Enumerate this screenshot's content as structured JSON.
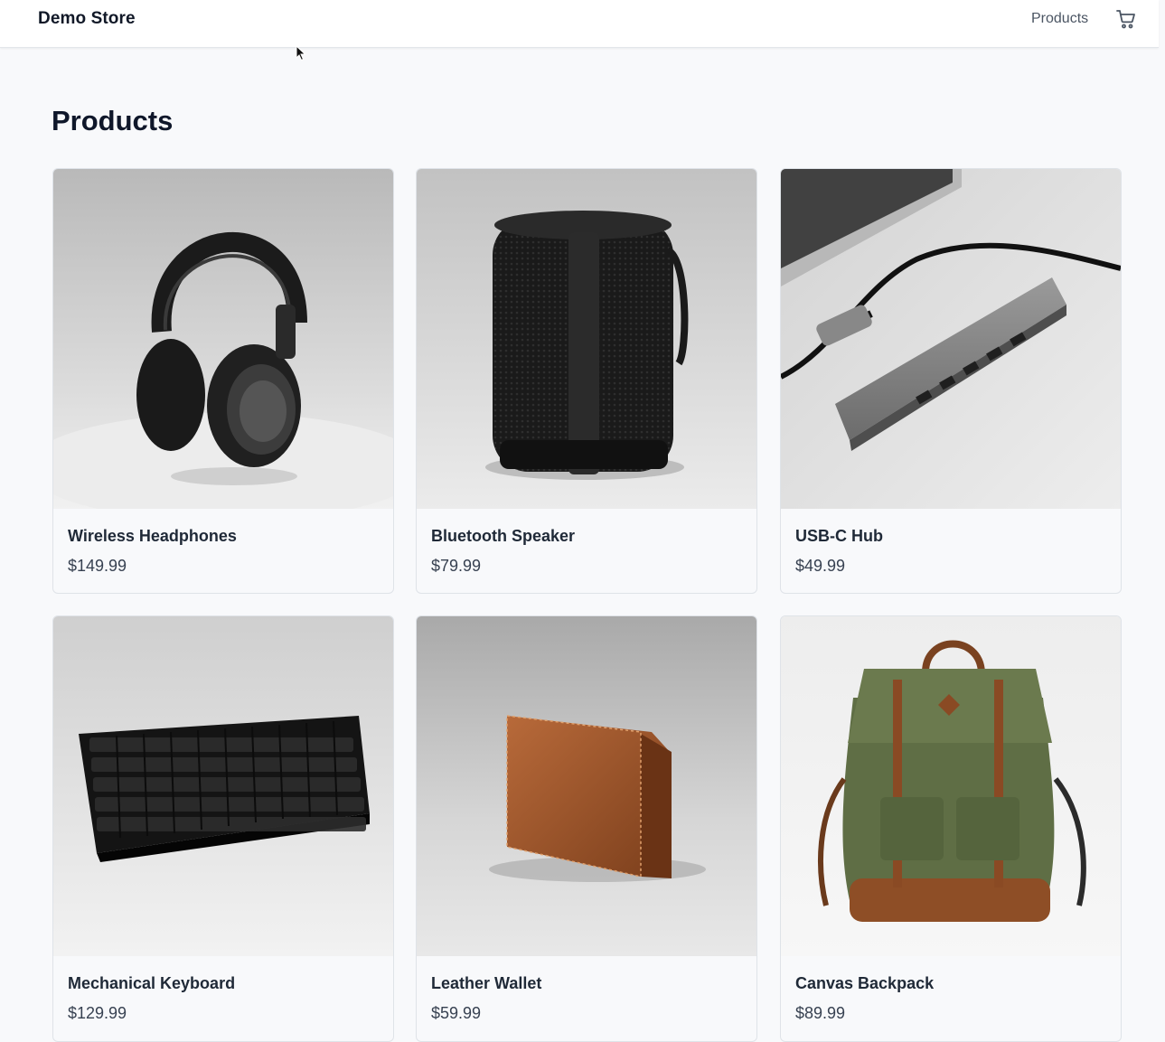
{
  "header": {
    "brand": "Demo Store",
    "nav_products": "Products",
    "cart_icon": "cart-icon"
  },
  "main": {
    "title": "Products",
    "products": [
      {
        "name": "Wireless Headphones",
        "price": "$149.99",
        "image": "headphones"
      },
      {
        "name": "Bluetooth Speaker",
        "price": "$79.99",
        "image": "speaker"
      },
      {
        "name": "USB-C Hub",
        "price": "$49.99",
        "image": "usb-hub"
      },
      {
        "name": "Mechanical Keyboard",
        "price": "$129.99",
        "image": "keyboard"
      },
      {
        "name": "Leather Wallet",
        "price": "$59.99",
        "image": "wallet"
      },
      {
        "name": "Canvas Backpack",
        "price": "$89.99",
        "image": "backpack"
      }
    ]
  },
  "colors": {
    "background": "#f8f9fb",
    "header_bg": "#ffffff",
    "text": "#0f172a",
    "muted": "#4b5563"
  }
}
